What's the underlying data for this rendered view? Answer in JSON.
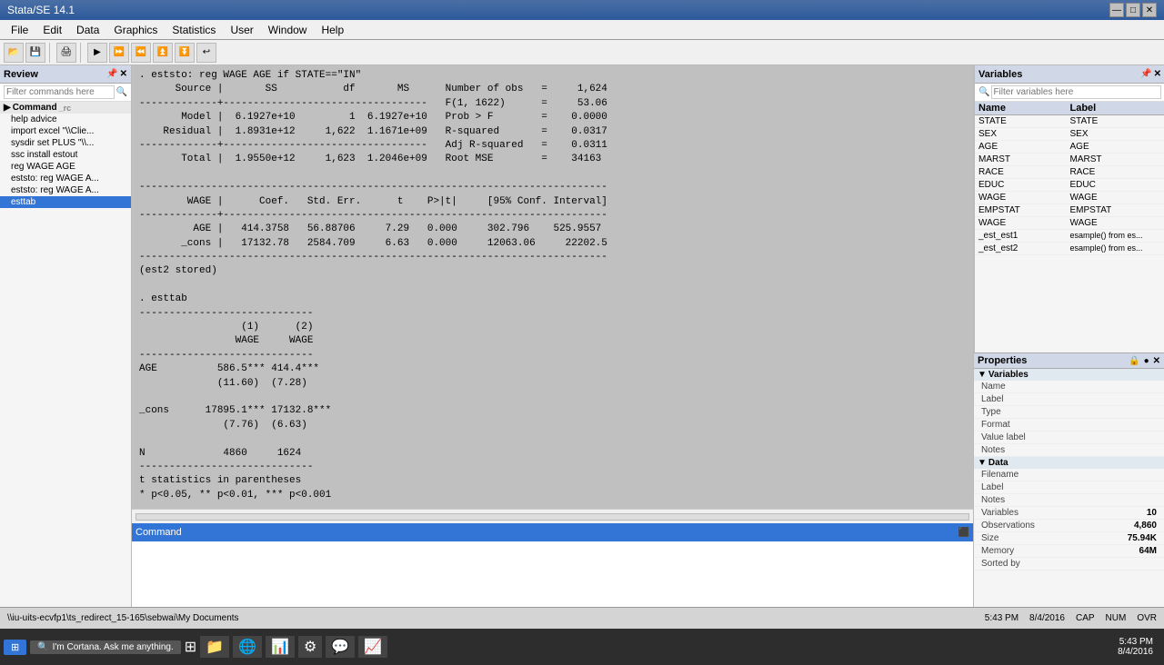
{
  "window": {
    "title": "Stata/SE 14.1",
    "minimize": "—",
    "maximize": "□",
    "close": "✕"
  },
  "menu": {
    "items": [
      "File",
      "Edit",
      "Data",
      "Graphics",
      "Statistics",
      "User",
      "Window",
      "Help"
    ]
  },
  "review": {
    "panel_title": "Review",
    "search_placeholder": "Filter commands here",
    "section_label": "Command",
    "help_label": "help advice",
    "items": [
      {
        "label": "import excel \"\\\\Clie...",
        "active": false
      },
      {
        "label": "sysdir set PLUS \"\\\\...",
        "active": false
      },
      {
        "label": "ssc install estout",
        "active": false
      },
      {
        "label": "reg WAGE AGE",
        "active": false
      },
      {
        "label": "eststo: reg WAGE A...",
        "active": false
      },
      {
        "label": "eststo: reg WAGE A...",
        "active": false
      },
      {
        "label": "esttab",
        "active": true
      }
    ]
  },
  "output": {
    "command1": ". eststo: reg WAGE AGE if STATE==\"IN\"",
    "reg_table": {
      "header": [
        "Source",
        "SS",
        "df",
        "MS"
      ],
      "stats_right": [
        [
          "Number of obs",
          "=",
          "1,624"
        ],
        [
          "F(1, 1622)",
          "=",
          "53.06"
        ],
        [
          "Prob > F",
          "=",
          "0.0000"
        ],
        [
          "R-squared",
          "=",
          "0.0317"
        ],
        [
          "Adj R-squared",
          "=",
          "0.0311"
        ],
        [
          "Root MSE",
          "=",
          "34163"
        ]
      ],
      "rows": [
        [
          "Model",
          "6.1927e+10",
          "1",
          "6.1927e+10"
        ],
        [
          "Residual",
          "1.8931e+12",
          "1,622",
          "1.1671e+09"
        ],
        [
          "Total",
          "1.9550e+12",
          "1,623",
          "1.2046e+09"
        ]
      ],
      "coef_header": [
        "WAGE",
        "Coef.",
        "Std. Err.",
        "t",
        "P>|t|",
        "[95% Conf.",
        "Interval]"
      ],
      "coef_rows": [
        [
          "AGE",
          "414.3758",
          "56.88706",
          "7.29",
          "0.000",
          "302.796",
          "525.9557"
        ],
        [
          "_cons",
          "17132.78",
          "2584.709",
          "6.63",
          "0.000",
          "12063.06",
          "22202.5"
        ]
      ]
    },
    "stored_msg": "(est2 stored)",
    "cmd2": ". esttab",
    "esttab_table": {
      "col1": "(1)",
      "col2": "(2)",
      "dep1": "WAGE",
      "dep2": "WAGE",
      "rows": [
        {
          "label": "AGE",
          "v1": "586.5***",
          "v1se": "(11.60)",
          "v2": "414.4***",
          "v2se": "(7.28)"
        },
        {
          "label": "_cons",
          "v1": "17895.1***",
          "v1se": "(7.76)",
          "v2": "17132.8***",
          "v2se": "(6.63)"
        }
      ],
      "n_row": {
        "label": "N",
        "v1": "4860",
        "v2": "1624"
      },
      "footnote1": "t statistics in parentheses",
      "footnote2": "* p<0.05, ** p<0.01, *** p<0.001"
    }
  },
  "variables": {
    "panel_title": "Variables",
    "search_placeholder": "Filter variables here",
    "col_name": "Name",
    "col_label": "Label",
    "items": [
      {
        "name": "STATE",
        "label": "STATE"
      },
      {
        "name": "SEX",
        "label": "SEX"
      },
      {
        "name": "AGE",
        "label": "AGE"
      },
      {
        "name": "MARST",
        "label": "MARST"
      },
      {
        "name": "RACE",
        "label": "RACE"
      },
      {
        "name": "EDUC",
        "label": "EDUC"
      },
      {
        "name": "WAGE",
        "label": "WAGE"
      },
      {
        "name": "EMPSTAT",
        "label": "EMPSTAT"
      },
      {
        "name": "WAGE",
        "label": "WAGE"
      },
      {
        "name": "_est_est1",
        "label": "esample() from es..."
      },
      {
        "name": "_est_est2",
        "label": "esample() from es..."
      }
    ]
  },
  "properties": {
    "panel_title": "Properties",
    "sections": {
      "variables": {
        "label": "Variables",
        "fields": [
          {
            "label": "Name",
            "value": ""
          },
          {
            "label": "Label",
            "value": ""
          },
          {
            "label": "Type",
            "value": ""
          },
          {
            "label": "Format",
            "value": ""
          },
          {
            "label": "Value label",
            "value": ""
          },
          {
            "label": "Notes",
            "value": ""
          }
        ]
      },
      "data": {
        "label": "Data",
        "fields": [
          {
            "label": "Filename",
            "value": ""
          },
          {
            "label": "Label",
            "value": ""
          },
          {
            "label": "Notes",
            "value": ""
          },
          {
            "label": "Variables",
            "value": "10"
          },
          {
            "label": "Observations",
            "value": "4,860"
          },
          {
            "label": "Size",
            "value": "75.94K"
          },
          {
            "label": "Memory",
            "value": "64M"
          },
          {
            "label": "Sorted by",
            "value": ""
          }
        ]
      }
    }
  },
  "command": {
    "label": "Command",
    "input_value": ""
  },
  "status": {
    "path": "\\\\iu-uits-ecvfp1\\ts_redirect_15-165\\sebwai\\My Documents",
    "cap": "CAP",
    "num": "NUM",
    "ovr": "OVR"
  },
  "time": {
    "time": "5:43 PM",
    "date": "8/4/2016"
  }
}
